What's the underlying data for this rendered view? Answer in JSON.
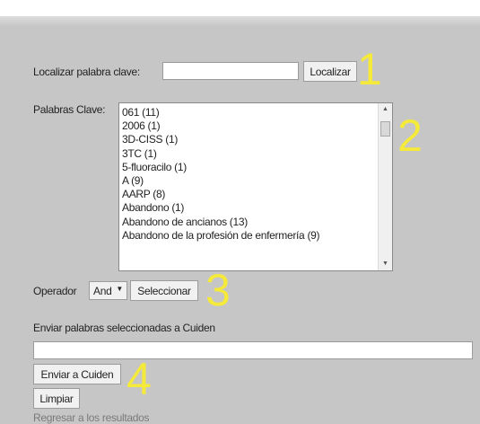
{
  "search": {
    "label": "Localizar palabra clave:",
    "value": "",
    "button": "Localizar"
  },
  "keywords": {
    "label": "Palabras Clave:",
    "options": [
      "061 (11)",
      "2006 (1)",
      "3D-CISS (1)",
      "3TC (1)",
      "5-fluoracilo (1)",
      "A (9)",
      "AARP (8)",
      "Abandono (1)",
      "Abandono de ancianos (13)",
      "Abandono de la profesión de enfermería (9)"
    ]
  },
  "operator": {
    "label": "Operador",
    "selected": "And",
    "button": "Seleccionar"
  },
  "send": {
    "label": "Enviar palabras seleccionadas a Cuiden",
    "value": "",
    "send_button": "Enviar a Cuiden",
    "clear_button": "Limpiar",
    "back_link": "Regresar a los resultados"
  },
  "annotations": [
    "1",
    "2",
    "3",
    "4"
  ],
  "colors": {
    "background": "#c6c6c6",
    "annotation": "#f5ea3a"
  }
}
